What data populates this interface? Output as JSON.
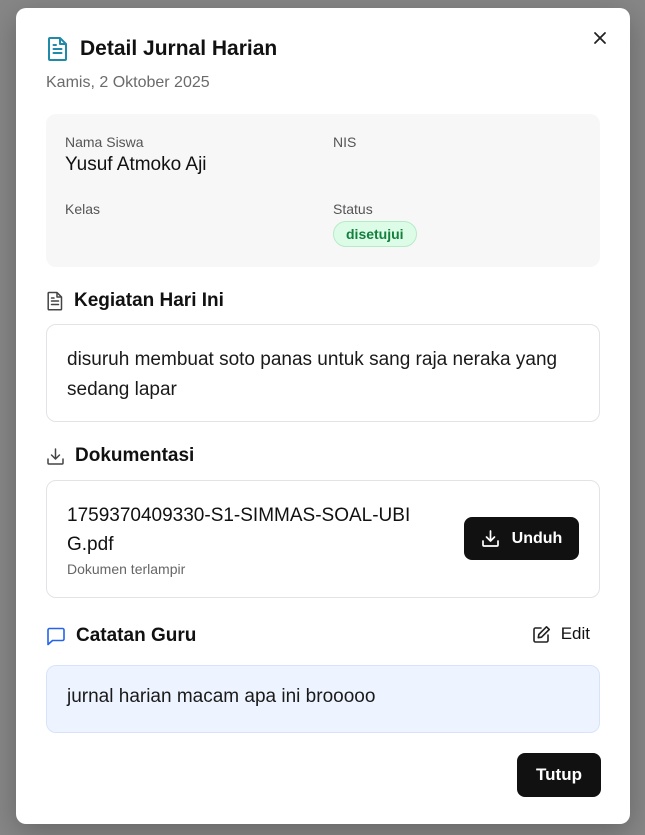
{
  "modal": {
    "title": "Detail Jurnal Harian",
    "date": "Kamis, 2 Oktober 2025"
  },
  "student": {
    "name_label": "Nama Siswa",
    "name_value": "Yusuf Atmoko Aji",
    "nis_label": "NIS",
    "nis_value": "",
    "class_label": "Kelas",
    "class_value": "",
    "status_label": "Status",
    "status_value": "disetujui"
  },
  "activity": {
    "heading": "Kegiatan Hari Ini",
    "text": "disuruh membuat soto panas untuk sang raja neraka yang sedang lapar"
  },
  "documentation": {
    "heading": "Dokumentasi",
    "file_name": "1759370409330-S1-SIMMAS-SOAL-UBIG.pdf",
    "file_caption": "Dokumen terlampir",
    "download_label": "Unduh"
  },
  "teacher_note": {
    "heading": "Catatan Guru",
    "edit_label": "Edit",
    "text": "jurnal harian macam apa ini brooooo"
  },
  "footer": {
    "close_label": "Tutup"
  },
  "colors": {
    "accent_icon": "#1f8ba8",
    "note_icon": "#2563eb",
    "status_green": "#15803d",
    "status_bg": "#dcfce7",
    "button_dark": "#111111",
    "note_bg": "#eef4ff"
  },
  "icons": {
    "title": "document-text-icon",
    "close": "close-icon",
    "activity": "document-icon",
    "documentation": "download-icon",
    "download_button": "download-icon",
    "note": "chat-bubble-icon",
    "edit": "edit-pencil-icon"
  }
}
